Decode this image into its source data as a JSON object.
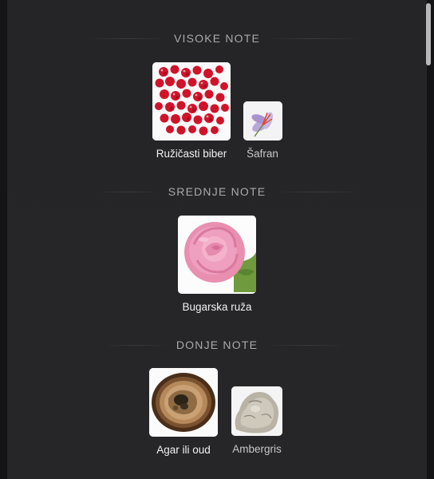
{
  "sections": [
    {
      "title": "VISOKE NOTE",
      "notes": [
        {
          "label": "Ružičasti biber",
          "icon": "pink-pepper-icon"
        },
        {
          "label": "Šafran",
          "icon": "saffron-icon"
        }
      ]
    },
    {
      "title": "SREDNJE NOTE",
      "notes": [
        {
          "label": "Bugarska ruža",
          "icon": "rose-icon"
        }
      ]
    },
    {
      "title": "DONJE NOTE",
      "notes": [
        {
          "label": "Agar ili oud",
          "icon": "agarwood-icon"
        },
        {
          "label": "Ambergris",
          "icon": "ambergris-icon"
        }
      ]
    }
  ],
  "colors": {
    "background": "#252527",
    "heading": "#a9a9ae",
    "label": "#f2f2f4"
  }
}
